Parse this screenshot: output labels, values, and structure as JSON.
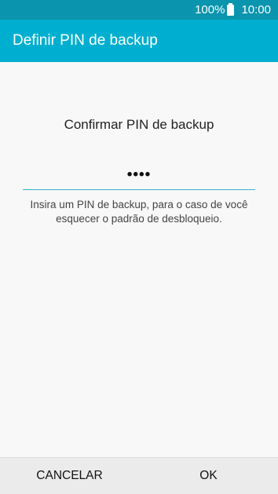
{
  "status_bar": {
    "battery_percent": "100%",
    "time": "10:00"
  },
  "app_bar": {
    "title": "Definir PIN de backup"
  },
  "main": {
    "prompt_title": "Confirmar PIN de backup",
    "pin_value": "••••",
    "helper_text": "Insira um PIN de backup, para o caso de você esquecer o padrão de desbloqueio."
  },
  "buttons": {
    "cancel_label": "CANCELAR",
    "ok_label": "OK"
  },
  "colors": {
    "status_bar": "#0a94ad",
    "app_bar": "#00afd0",
    "input_underline": "#39b2d1",
    "background": "#f8f8f8",
    "button_bar": "#ebebeb"
  },
  "icons": {
    "battery": "battery-icon"
  }
}
